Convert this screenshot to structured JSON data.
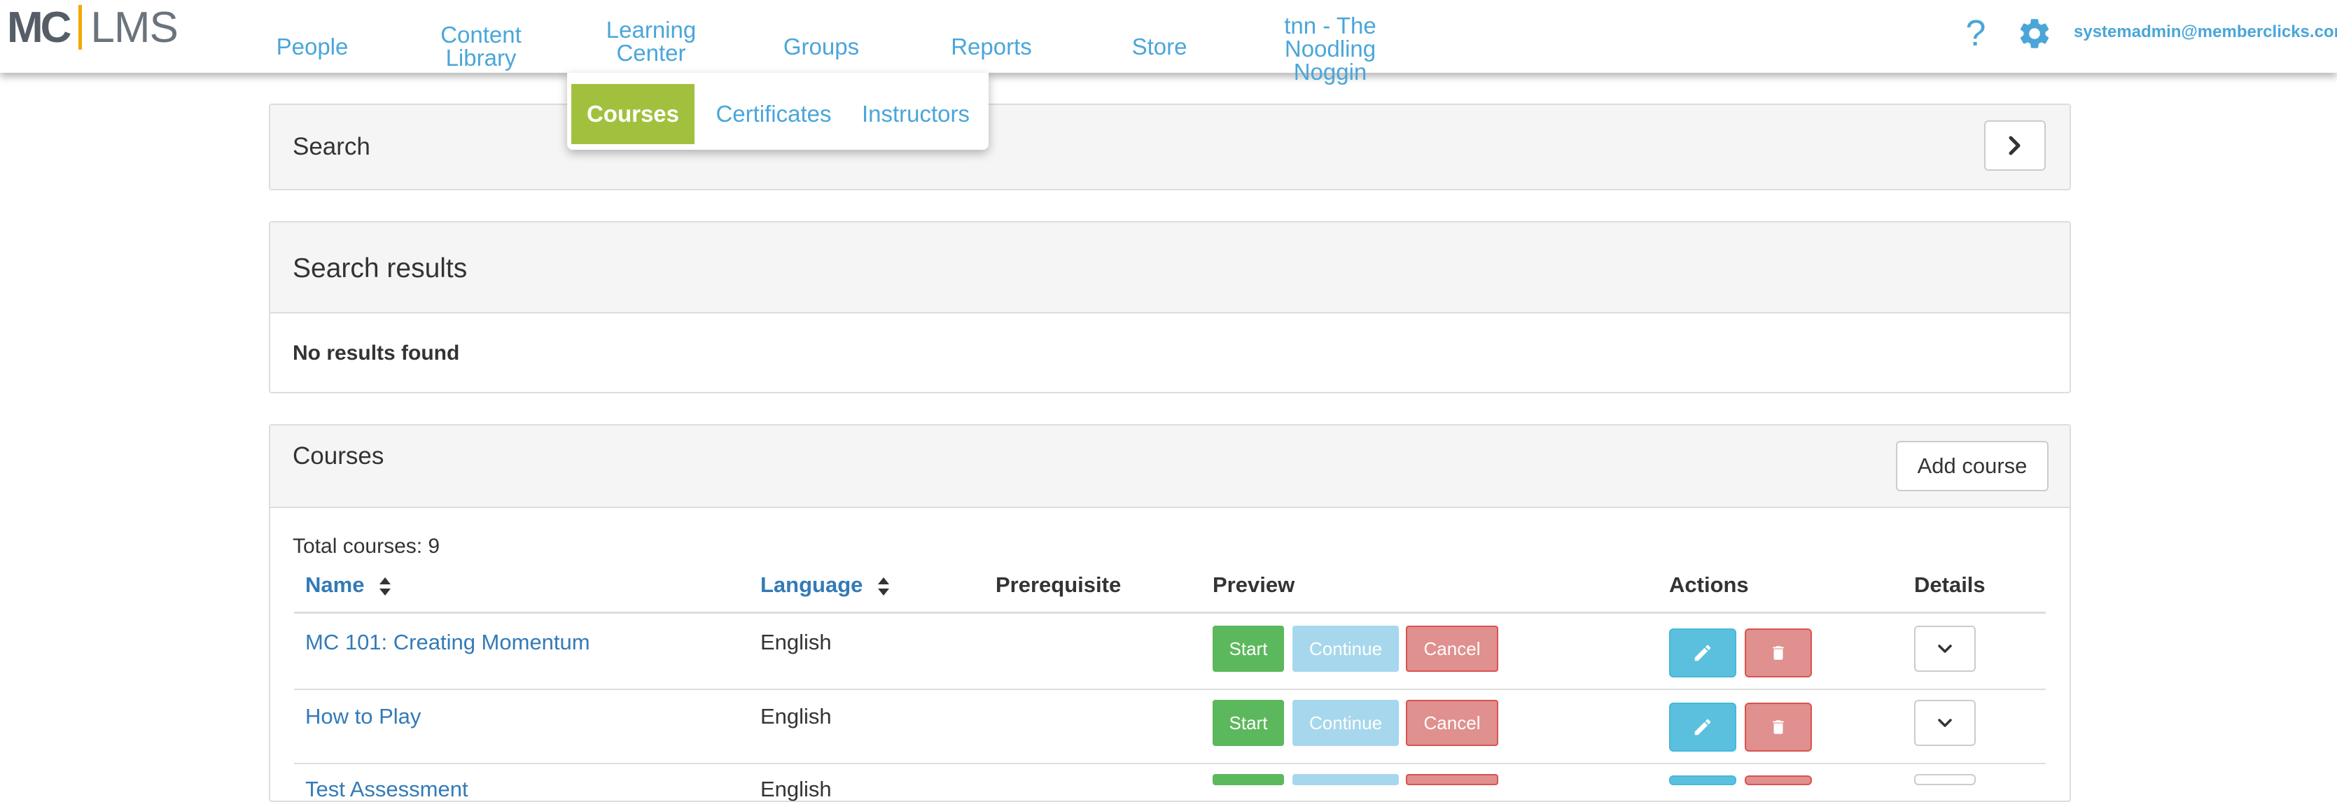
{
  "logo": {
    "left": "MC",
    "right": "LMS"
  },
  "nav": {
    "people": "People",
    "content_library": [
      "Content",
      "Library"
    ],
    "learning_center": [
      "Learning",
      "Center"
    ],
    "groups": "Groups",
    "reports": "Reports",
    "store": "Store",
    "site": [
      "tnn - The",
      "Noodling",
      "Noggin"
    ]
  },
  "header_right": {
    "help": "?",
    "user_email": "systemadmin@memberclicks.com"
  },
  "submenu": {
    "courses": "Courses",
    "certificates": "Certificates",
    "instructors": "Instructors"
  },
  "search_panel": {
    "title": "Search"
  },
  "results_panel": {
    "title": "Search results",
    "message": "No results found"
  },
  "courses_panel": {
    "title": "Courses",
    "add_button": "Add course",
    "total_label": "Total courses: 9",
    "columns": {
      "name": "Name",
      "language": "Language",
      "prerequisite": "Prerequisite",
      "preview": "Preview",
      "actions": "Actions",
      "details": "Details"
    },
    "preview_buttons": {
      "start": "Start",
      "continue": "Continue",
      "cancel": "Cancel"
    },
    "rows": [
      {
        "name": "MC 101: Creating Momentum",
        "language": "English"
      },
      {
        "name": "How to Play",
        "language": "English"
      },
      {
        "name": "Test Assessment",
        "language": "English"
      }
    ]
  },
  "colors": {
    "link": "#337ab7",
    "nav_link": "#4aa6d9",
    "active_submenu": "#a1c13e",
    "start": "#5cb85c",
    "continue": "#a7d7ec",
    "cancel": "#e0908e",
    "edit": "#5bc0de",
    "logo_accent": "#f2a900"
  }
}
